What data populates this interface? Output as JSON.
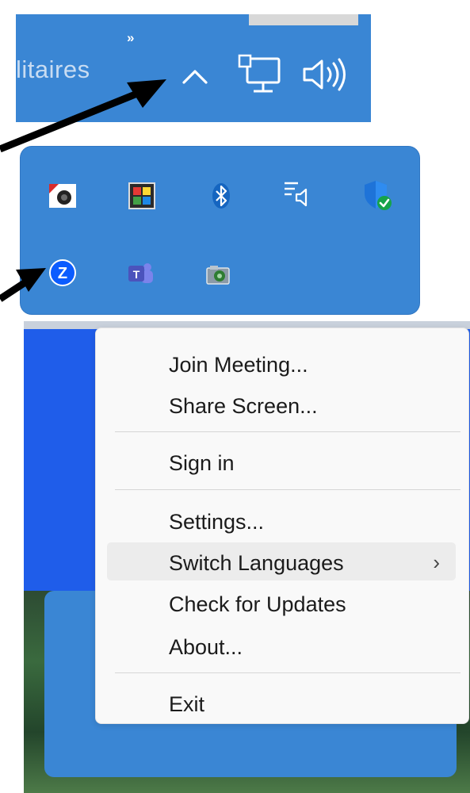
{
  "taskbar": {
    "app_label": "litaires",
    "overflow_label": "»",
    "tray_icons": [
      "chevron-up-icon",
      "network-icon",
      "volume-icon"
    ]
  },
  "tray": {
    "row1": [
      "webcam-app-icon",
      "color-tool-icon",
      "bluetooth-icon",
      "audio-list-icon",
      "windows-security-icon"
    ],
    "row2": [
      "zoom-icon",
      "teams-icon",
      "camera-icon"
    ]
  },
  "context_menu": {
    "items": [
      {
        "label": "Join Meeting..."
      },
      {
        "label": "Share Screen..."
      },
      {
        "label": "Sign in"
      },
      {
        "label": "Settings..."
      },
      {
        "label": "Switch Languages",
        "submenu_arrow": "›",
        "highlighted": true
      },
      {
        "label": "Check for Updates"
      },
      {
        "label": "About..."
      },
      {
        "label": "Exit"
      }
    ]
  },
  "colors": {
    "taskbar_blue": "#3a86d4",
    "desktop_blue": "#1f5dea",
    "menu_bg": "#f9f9f9",
    "menu_hover": "#ececec",
    "zoom_blue": "#2d8cff",
    "teams_purple": "#5b5fc7",
    "security_green": "#16a34a"
  }
}
